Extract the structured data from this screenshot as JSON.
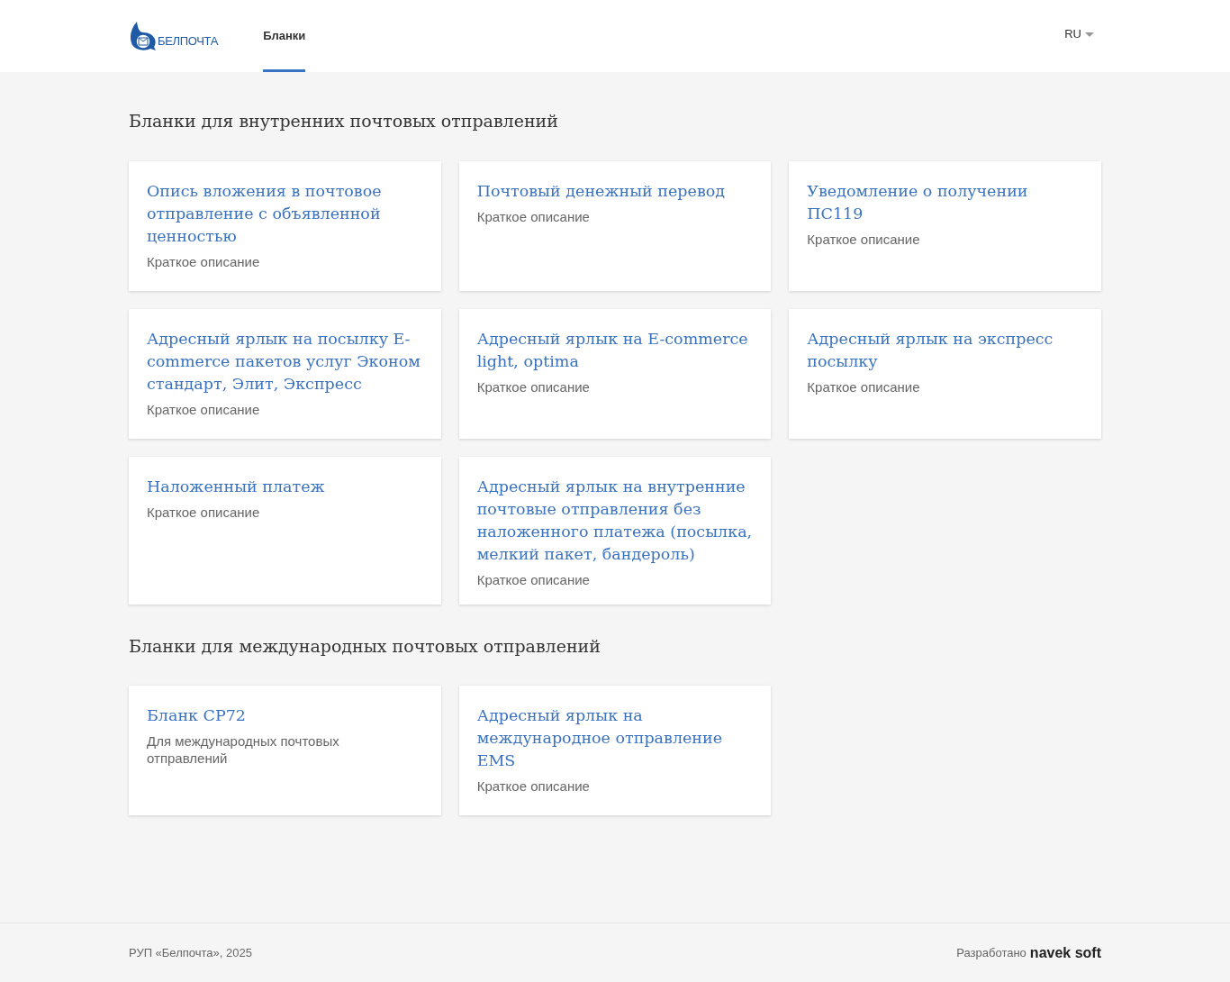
{
  "header": {
    "logo_text": "БЕЛПОЧТА",
    "nav": [
      {
        "label": "Бланки",
        "selected": true
      }
    ],
    "language": "RU"
  },
  "sections": [
    {
      "title": "Бланки для внутренних почтовых отправлений",
      "cards": [
        {
          "title": "Опись вложения в почтовое отправление с объявленной ценностью",
          "description": "Краткое описание"
        },
        {
          "title": "Почтовый денежный перевод",
          "description": "Краткое описание"
        },
        {
          "title": "Уведомление о получении ПС119",
          "description": "Краткое описание"
        },
        {
          "title": "Адресный ярлык на посылку E-commerce пакетов услуг Эконом стандарт, Элит, Экспресс",
          "description": "Краткое описание"
        },
        {
          "title": "Адресный ярлык на E-commerce light, optima",
          "description": "Краткое описание"
        },
        {
          "title": "Адресный ярлык на экспресс посылку",
          "description": "Краткое описание"
        },
        {
          "title": "Наложенный платеж",
          "description": "Краткое описание"
        },
        {
          "title": "Адресный ярлык на внутренние почтовые отправления без наложенного платежа (посылка, мелкий пакет, бандероль)",
          "description": "Краткое описание"
        }
      ]
    },
    {
      "title": "Бланки для международных почтовых отправлений",
      "cards": [
        {
          "title": "Бланк CP72",
          "description": "Для международных почтовых отправлений"
        },
        {
          "title": "Адресный ярлык на международное отправление EMS",
          "description": "Краткое описание"
        }
      ]
    }
  ],
  "footer": {
    "copyright": "РУП «Белпочта», 2025",
    "developed_by": "Разработано",
    "developer": "navek soft"
  }
}
